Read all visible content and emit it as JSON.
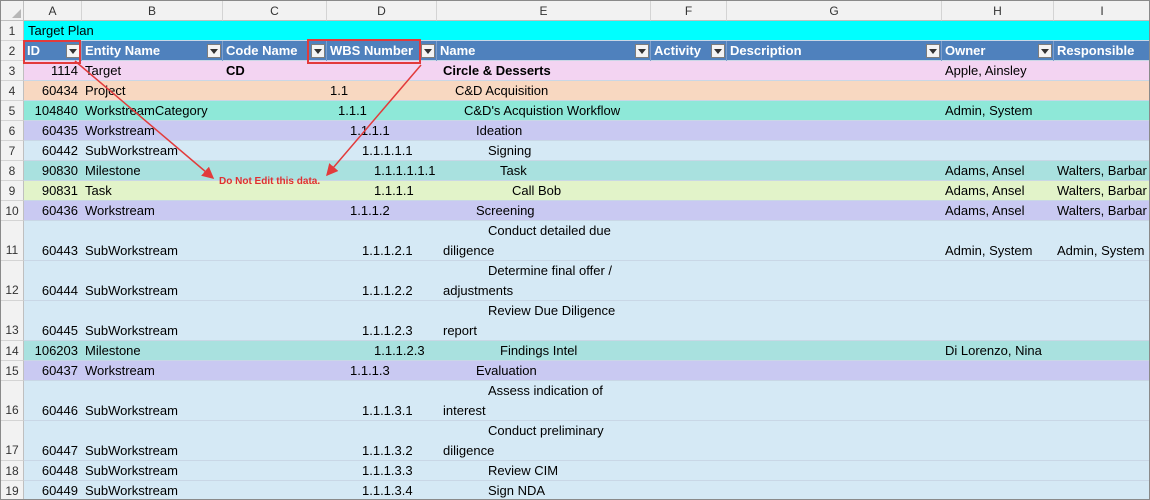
{
  "columns": [
    "A",
    "B",
    "C",
    "D",
    "E",
    "F",
    "G",
    "H",
    "I"
  ],
  "title_row": {
    "row": "1",
    "text": "Target Plan"
  },
  "header_row": {
    "row": "2",
    "id": "ID",
    "entity_name": "Entity Name",
    "code_name": "Code Name",
    "wbs_number": "WBS Number",
    "name": "Name",
    "activity": "Activity",
    "description": "Description",
    "owner": "Owner",
    "responsible": "Responsible"
  },
  "rows": [
    {
      "row": "3",
      "id": "1114",
      "entity": "Target",
      "code": "CD",
      "wbs": "",
      "name": "Circle & Desserts",
      "name2": "",
      "owner": "Apple, Ainsley",
      "responsible": ""
    },
    {
      "row": "4",
      "id": "60434",
      "entity": "Project",
      "code": "",
      "wbs": "1.1",
      "name": "C&D Acquisition",
      "name2": "",
      "owner": "",
      "responsible": ""
    },
    {
      "row": "5",
      "id": "104840",
      "entity": "WorkstreamCategory",
      "code": "",
      "wbs": "1.1.1",
      "name": "C&D's Acquistion Workflow",
      "name2": "",
      "owner": "Admin, System",
      "responsible": ""
    },
    {
      "row": "6",
      "id": "60435",
      "entity": "Workstream",
      "code": "",
      "wbs": "1.1.1.1",
      "name": "Ideation",
      "name2": "",
      "owner": "",
      "responsible": ""
    },
    {
      "row": "7",
      "id": "60442",
      "entity": "SubWorkstream",
      "code": "",
      "wbs": "1.1.1.1.1",
      "name": "Signing",
      "name2": "",
      "owner": "",
      "responsible": ""
    },
    {
      "row": "8",
      "id": "90830",
      "entity": "Milestone",
      "code": "",
      "wbs": "1.1.1.1.1.1",
      "name": "Task",
      "name2": "",
      "owner": "Adams, Ansel",
      "responsible": "Walters, Barbar"
    },
    {
      "row": "9",
      "id": "90831",
      "entity": "Task",
      "code": "",
      "wbs": "1.1.1.1",
      "name": "Call Bob",
      "name2": "",
      "owner": "Adams, Ansel",
      "responsible": "Walters, Barbar"
    },
    {
      "row": "10",
      "id": "60436",
      "entity": "Workstream",
      "code": "",
      "wbs": "1.1.1.2",
      "name": "Screening",
      "name2": "",
      "owner": "Adams, Ansel",
      "responsible": "Walters, Barbar"
    },
    {
      "row": "11",
      "id": "60443",
      "entity": "SubWorkstream",
      "code": "",
      "wbs": "1.1.1.2.1",
      "name": "Conduct detailed due",
      "name2": "diligence",
      "owner": "Admin, System",
      "responsible": "Admin, System"
    },
    {
      "row": "12",
      "id": "60444",
      "entity": "SubWorkstream",
      "code": "",
      "wbs": "1.1.1.2.2",
      "name": "Determine final offer /",
      "name2": "adjustments",
      "owner": "",
      "responsible": ""
    },
    {
      "row": "13",
      "id": "60445",
      "entity": "SubWorkstream",
      "code": "",
      "wbs": "1.1.1.2.3",
      "name": "Review Due Diligence",
      "name2": "report",
      "owner": "",
      "responsible": ""
    },
    {
      "row": "14",
      "id": "106203",
      "entity": "Milestone",
      "code": "",
      "wbs": "1.1.1.2.3",
      "name": "Findings Intel",
      "name2": "",
      "owner": "Di Lorenzo, Nina",
      "responsible": ""
    },
    {
      "row": "15",
      "id": "60437",
      "entity": "Workstream",
      "code": "",
      "wbs": "1.1.1.3",
      "name": "Evaluation",
      "name2": "",
      "owner": "",
      "responsible": ""
    },
    {
      "row": "16",
      "id": "60446",
      "entity": "SubWorkstream",
      "code": "",
      "wbs": "1.1.1.3.1",
      "name": "Assess indication of",
      "name2": "interest",
      "owner": "",
      "responsible": ""
    },
    {
      "row": "17",
      "id": "60447",
      "entity": "SubWorkstream",
      "code": "",
      "wbs": "1.1.1.3.2",
      "name": "Conduct preliminary",
      "name2": "diligence",
      "owner": "",
      "responsible": ""
    },
    {
      "row": "18",
      "id": "60448",
      "entity": "SubWorkstream",
      "code": "",
      "wbs": "1.1.1.3.3",
      "name": "Review CIM",
      "name2": "",
      "owner": "",
      "responsible": ""
    },
    {
      "row": "19",
      "id": "60449",
      "entity": "SubWorkstream",
      "code": "",
      "wbs": "1.1.1.3.4",
      "name": "Sign NDA",
      "name2": "",
      "owner": "",
      "responsible": ""
    }
  ],
  "annotation": {
    "text": "Do Not Edit this data."
  },
  "colors": {
    "title_row": "#00ffff",
    "header": "#4f81bd",
    "target": "#f3d4f2",
    "project": "#f8d8c1",
    "workstream_category": "#8ee8d8",
    "workstream": "#c9c9f2",
    "subworkstream": "#d5e9f5",
    "milestone": "#a9e1df",
    "task": "#e2f3c9",
    "annotation": "#e23b3b"
  }
}
